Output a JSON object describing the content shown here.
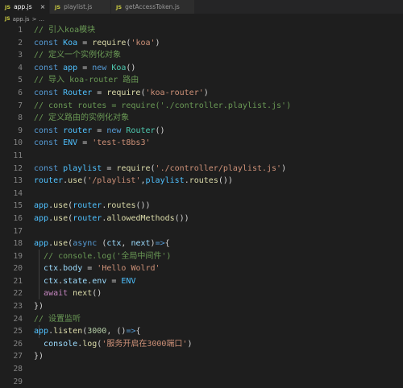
{
  "tabs": [
    {
      "label": "app.js",
      "icon": "JS",
      "active": true,
      "close": "×"
    },
    {
      "label": "playlist.js",
      "icon": "JS",
      "active": false
    },
    {
      "label": "getAccessToken.js",
      "icon": "JS",
      "active": false
    }
  ],
  "breadcrumb": {
    "icon": "JS",
    "file": "app.js",
    "sep": ">",
    "more": "..."
  },
  "lines": [
    {
      "n": "1",
      "t": [
        [
          "c",
          "// 引入koa模块"
        ]
      ]
    },
    {
      "n": "2",
      "t": [
        [
          "k",
          "const "
        ],
        [
          "v",
          "Koa"
        ],
        [
          "p",
          " = "
        ],
        [
          "f",
          "require"
        ],
        [
          "p",
          "("
        ],
        [
          "s",
          "'koa'"
        ],
        [
          "p",
          ")"
        ]
      ]
    },
    {
      "n": "3",
      "t": [
        [
          "c",
          "// 定义一个实例化对象"
        ]
      ]
    },
    {
      "n": "4",
      "t": [
        [
          "k",
          "const "
        ],
        [
          "v",
          "app"
        ],
        [
          "p",
          " = "
        ],
        [
          "k",
          "new "
        ],
        [
          "cls",
          "Koa"
        ],
        [
          "p",
          "()"
        ]
      ]
    },
    {
      "n": "5",
      "t": [
        [
          "c",
          "// 导入 koa-router 路由"
        ]
      ]
    },
    {
      "n": "6",
      "t": [
        [
          "k",
          "const "
        ],
        [
          "v",
          "Router"
        ],
        [
          "p",
          " = "
        ],
        [
          "f",
          "require"
        ],
        [
          "p",
          "("
        ],
        [
          "s",
          "'koa-router'"
        ],
        [
          "p",
          ")"
        ]
      ]
    },
    {
      "n": "7",
      "t": [
        [
          "c",
          "// const routes = require('./controller.playlist.js')"
        ]
      ]
    },
    {
      "n": "8",
      "t": [
        [
          "c",
          "// 定义路由的实例化对象"
        ]
      ]
    },
    {
      "n": "9",
      "t": [
        [
          "k",
          "const "
        ],
        [
          "v",
          "router"
        ],
        [
          "p",
          " = "
        ],
        [
          "k",
          "new "
        ],
        [
          "cls",
          "Router"
        ],
        [
          "p",
          "()"
        ]
      ]
    },
    {
      "n": "10",
      "t": [
        [
          "k",
          "const "
        ],
        [
          "v",
          "ENV"
        ],
        [
          "p",
          " = "
        ],
        [
          "s",
          "'test-t8bs3'"
        ]
      ]
    },
    {
      "n": "11",
      "t": []
    },
    {
      "n": "12",
      "t": [
        [
          "k",
          "const "
        ],
        [
          "v",
          "playlist"
        ],
        [
          "p",
          " = "
        ],
        [
          "f",
          "require"
        ],
        [
          "p",
          "("
        ],
        [
          "s",
          "'./controller/playlist.js'"
        ],
        [
          "p",
          ")"
        ]
      ]
    },
    {
      "n": "13",
      "t": [
        [
          "v",
          "router"
        ],
        [
          "p",
          "."
        ],
        [
          "f",
          "use"
        ],
        [
          "p",
          "("
        ],
        [
          "s",
          "'/playlist'"
        ],
        [
          "p",
          ","
        ],
        [
          "v",
          "playlist"
        ],
        [
          "p",
          "."
        ],
        [
          "f",
          "routes"
        ],
        [
          "p",
          "())"
        ]
      ]
    },
    {
      "n": "14",
      "t": []
    },
    {
      "n": "15",
      "t": [
        [
          "v",
          "app"
        ],
        [
          "p",
          "."
        ],
        [
          "f",
          "use"
        ],
        [
          "p",
          "("
        ],
        [
          "v",
          "router"
        ],
        [
          "p",
          "."
        ],
        [
          "f",
          "routes"
        ],
        [
          "p",
          "())"
        ]
      ]
    },
    {
      "n": "16",
      "t": [
        [
          "v",
          "app"
        ],
        [
          "p",
          "."
        ],
        [
          "f",
          "use"
        ],
        [
          "p",
          "("
        ],
        [
          "v",
          "router"
        ],
        [
          "p",
          "."
        ],
        [
          "f",
          "allowedMethods"
        ],
        [
          "p",
          "())"
        ]
      ]
    },
    {
      "n": "17",
      "t": []
    },
    {
      "n": "18",
      "t": [
        [
          "v",
          "app"
        ],
        [
          "p",
          "."
        ],
        [
          "f",
          "use"
        ],
        [
          "p",
          "("
        ],
        [
          "k",
          "async "
        ],
        [
          "p",
          "("
        ],
        [
          "var",
          "ctx"
        ],
        [
          "p",
          ", "
        ],
        [
          "var",
          "next"
        ],
        [
          "p",
          ")"
        ],
        [
          "k",
          "=>"
        ],
        [
          "p",
          "{"
        ]
      ]
    },
    {
      "n": "19",
      "t": [
        [
          "p",
          "  "
        ],
        [
          "c",
          "// console.log('全局中间件')"
        ]
      ]
    },
    {
      "n": "20",
      "t": [
        [
          "p",
          "  "
        ],
        [
          "var",
          "ctx"
        ],
        [
          "p",
          "."
        ],
        [
          "var",
          "body"
        ],
        [
          "p",
          " = "
        ],
        [
          "s",
          "'Hello Wolrd'"
        ]
      ]
    },
    {
      "n": "21",
      "t": [
        [
          "p",
          "  "
        ],
        [
          "var",
          "ctx"
        ],
        [
          "p",
          "."
        ],
        [
          "var",
          "state"
        ],
        [
          "p",
          "."
        ],
        [
          "var",
          "env"
        ],
        [
          "p",
          " = "
        ],
        [
          "v",
          "ENV"
        ]
      ]
    },
    {
      "n": "22",
      "t": [
        [
          "p",
          "  "
        ],
        [
          "kc",
          "await "
        ],
        [
          "f",
          "next"
        ],
        [
          "p",
          "()"
        ]
      ]
    },
    {
      "n": "23",
      "t": [
        [
          "p",
          "})"
        ]
      ]
    },
    {
      "n": "24",
      "t": [
        [
          "c",
          "// 设置监听"
        ]
      ]
    },
    {
      "n": "25",
      "t": [
        [
          "v",
          "app"
        ],
        [
          "p",
          "."
        ],
        [
          "f",
          "listen"
        ],
        [
          "p",
          "("
        ],
        [
          "n",
          "3000"
        ],
        [
          "p",
          ", ()"
        ],
        [
          "k",
          "=>"
        ],
        [
          "p",
          "{"
        ]
      ]
    },
    {
      "n": "26",
      "t": [
        [
          "p",
          "  "
        ],
        [
          "var",
          "console"
        ],
        [
          "p",
          "."
        ],
        [
          "f",
          "log"
        ],
        [
          "p",
          "("
        ],
        [
          "s",
          "'服务开启在3000端口'"
        ],
        [
          "p",
          ")"
        ]
      ]
    },
    {
      "n": "27",
      "t": [
        [
          "p",
          "})"
        ]
      ]
    },
    {
      "n": "28",
      "t": []
    },
    {
      "n": "29",
      "t": []
    }
  ],
  "colors": {
    "keyword": "#569cd6",
    "control": "#c586c0",
    "constant": "#4fc1ff",
    "variable": "#9cdcfe",
    "function": "#dcdcaa",
    "string": "#ce9178",
    "comment": "#6a9955",
    "number": "#b5cea8",
    "class": "#4ec9b0"
  }
}
